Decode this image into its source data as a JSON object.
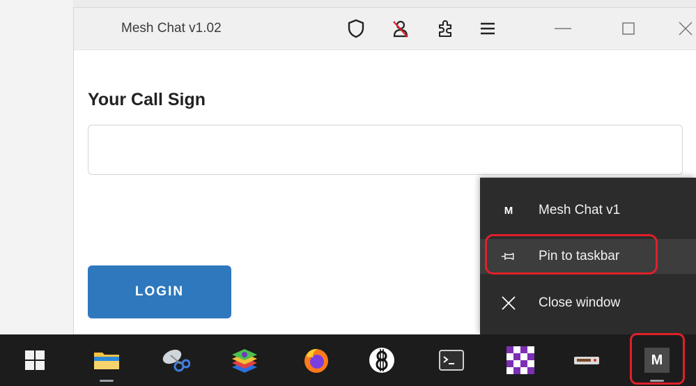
{
  "window": {
    "title": "Mesh Chat v1.02",
    "toolbar_icons": [
      "shield-icon",
      "account-blocked-icon",
      "extension-icon",
      "menu-icon"
    ],
    "controls": [
      "minimize-icon",
      "maximize-icon",
      "close-icon"
    ]
  },
  "form": {
    "callsign_label": "Your Call Sign",
    "callsign_value": "",
    "login_label": "LOGIN"
  },
  "jumplist": {
    "app_icon_letter": "M",
    "app_name": "Mesh Chat v1",
    "pin_label": "Pin to taskbar",
    "close_label": "Close window"
  },
  "taskbar": {
    "apps": [
      "start",
      "file-explorer",
      "snipping-tool",
      "bluestacks",
      "firefox",
      "app-8",
      "terminal",
      "checker-app",
      "device-app",
      "mesh-chat"
    ],
    "mesh_letter": "M"
  },
  "colors": {
    "accent": "#2f78bd",
    "highlight": "#e0202a",
    "menu_bg": "#2c2c2c",
    "taskbar_bg": "#1c1c1c"
  }
}
